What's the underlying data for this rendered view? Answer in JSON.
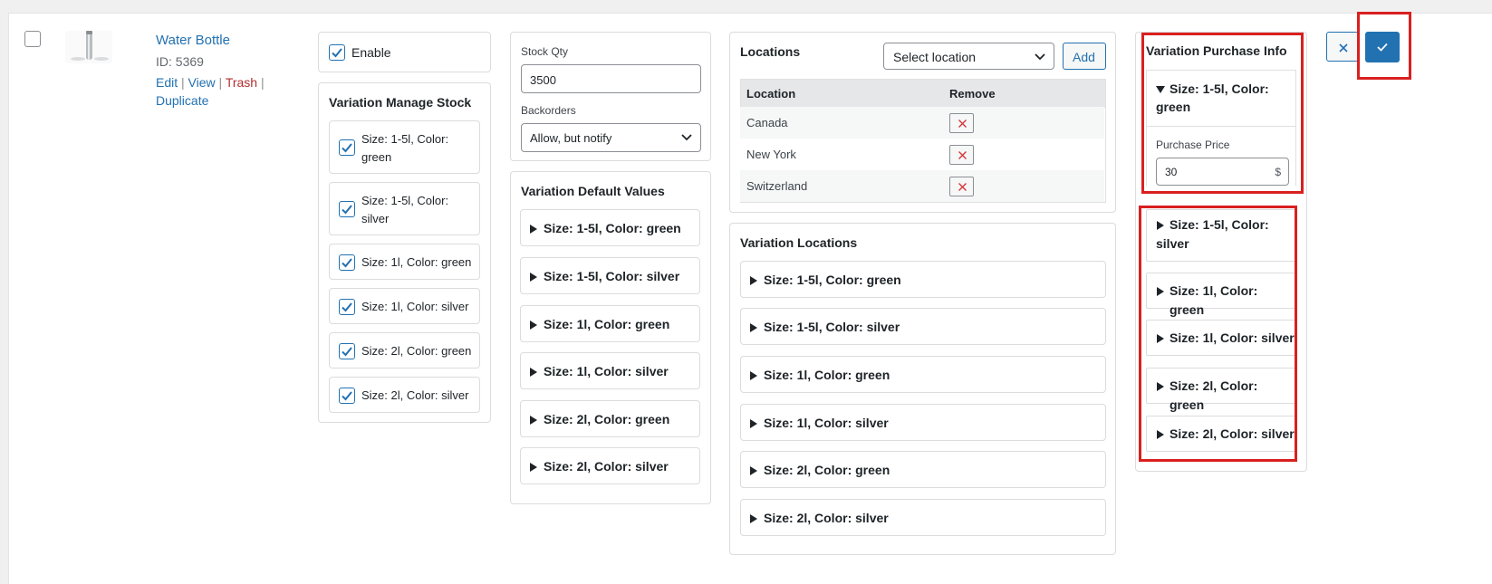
{
  "product": {
    "name": "Water Bottle",
    "id_text": "ID: 5369",
    "actions": {
      "edit": "Edit",
      "view": "View",
      "trash": "Trash",
      "duplicate": "Duplicate",
      "separator": "|"
    }
  },
  "enable": {
    "label": "Enable",
    "checked": true
  },
  "manage_stock": {
    "title": "Variation Manage Stock",
    "items": [
      {
        "line1": "Size: 1-5l, Color:",
        "line2": "green"
      },
      {
        "line1": "Size: 1-5l, Color:",
        "line2": "silver"
      },
      {
        "line1": "Size: 1l, Color: green",
        "line2": ""
      },
      {
        "line1": "Size: 1l, Color: silver",
        "line2": ""
      },
      {
        "line1": "Size: 2l, Color: green",
        "line2": ""
      },
      {
        "line1": "Size: 2l, Color: silver",
        "line2": ""
      }
    ]
  },
  "stock": {
    "qty_label": "Stock Qty",
    "qty_value": "3500",
    "backorders_label": "Backorders",
    "backorders_value": "Allow, but notify"
  },
  "default_values": {
    "title": "Variation Default Values",
    "items": [
      "Size: 1-5l, Color: green",
      "Size: 1-5l, Color: silver",
      "Size: 1l, Color: green",
      "Size: 1l, Color: silver",
      "Size: 2l, Color: green",
      "Size: 2l, Color: silver"
    ]
  },
  "locations": {
    "title": "Locations",
    "select_placeholder": "Select location",
    "add_label": "Add",
    "col_location": "Location",
    "col_remove": "Remove",
    "rows": [
      "Canada",
      "New York",
      "Switzerland"
    ]
  },
  "variation_locations": {
    "title": "Variation Locations",
    "items": [
      "Size: 1-5l, Color: green",
      "Size: 1-5l, Color: silver",
      "Size: 1l, Color: green",
      "Size: 1l, Color: silver",
      "Size: 2l, Color: green",
      "Size: 2l, Color: silver"
    ]
  },
  "purchase_info": {
    "title": "Variation Purchase Info",
    "open_item": {
      "line1": "Size: 1-5l, Color:",
      "line2": "green"
    },
    "price_label": "Purchase Price",
    "price_value": "30",
    "currency": "$",
    "items": [
      {
        "line1": "Size: 1-5l, Color:",
        "line2": "silver"
      },
      {
        "line1": "Size: 1l, Color: green",
        "line2": ""
      },
      {
        "line1": "Size: 1l, Color: silver",
        "line2": ""
      },
      {
        "line1": "Size: 2l, Color: green",
        "line2": ""
      },
      {
        "line1": "Size: 2l, Color: silver",
        "line2": ""
      }
    ]
  },
  "row_actions": {
    "cancel_icon": "close-icon",
    "save_icon": "check-icon"
  },
  "colors": {
    "accent": "#2271b1",
    "highlight": "#d9201f",
    "remove_x": "#d63638",
    "trash": "#b32d2e"
  }
}
